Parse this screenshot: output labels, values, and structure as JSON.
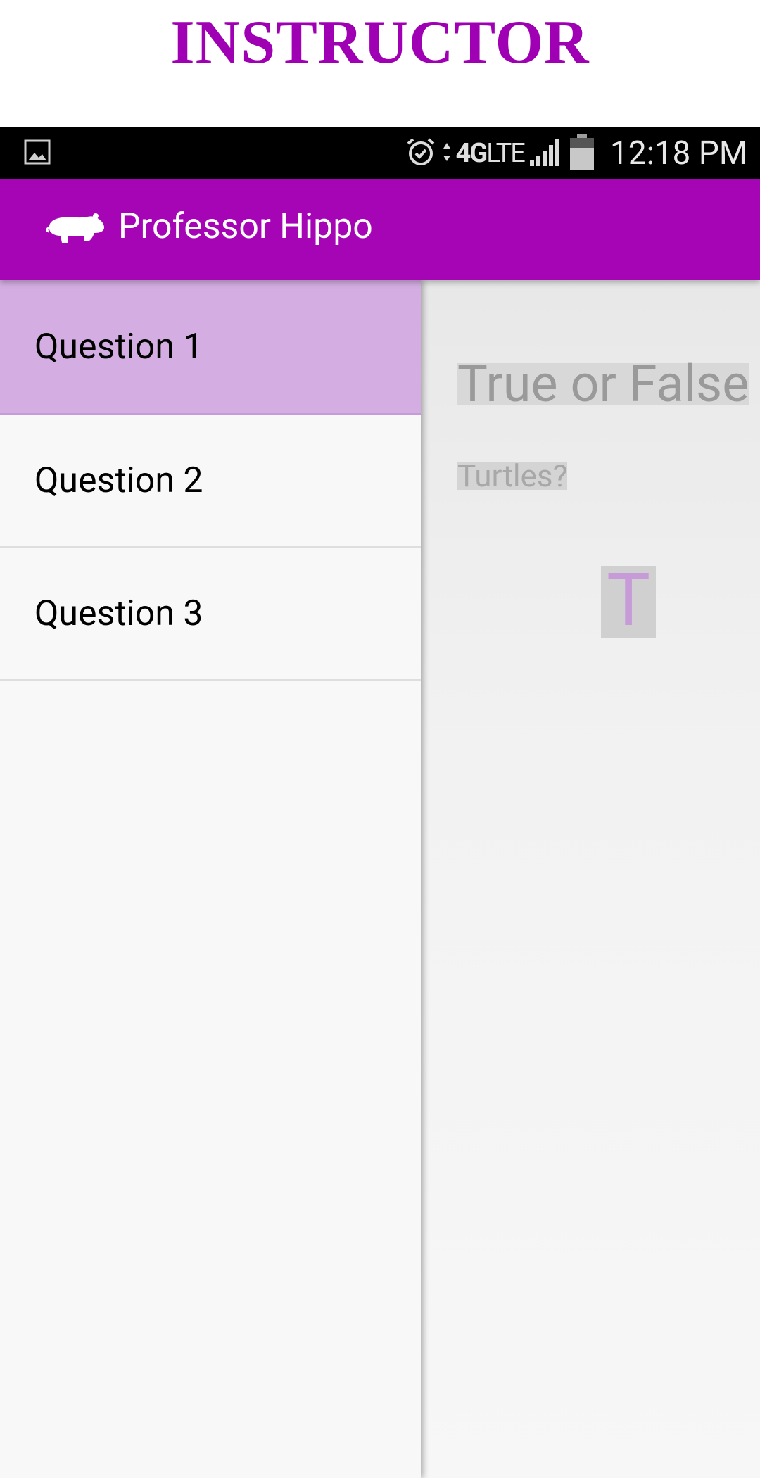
{
  "banner": {
    "title": "INSTRUCTOR"
  },
  "status_bar": {
    "network": "4G",
    "network_sub": "LTE",
    "time": "12:18 PM"
  },
  "app_bar": {
    "title": "Professor Hippo",
    "logo": "hippo-icon"
  },
  "drawer": {
    "items": [
      {
        "label": "Question 1",
        "selected": true
      },
      {
        "label": "Question 2",
        "selected": false
      },
      {
        "label": "Question 3",
        "selected": false
      }
    ]
  },
  "content": {
    "question_type": "True or False",
    "question_text": "Turtles?",
    "answer": "T"
  },
  "colors": {
    "accent": "#a605b6",
    "selected": "#d4aee3",
    "banner": "#a000b4"
  }
}
